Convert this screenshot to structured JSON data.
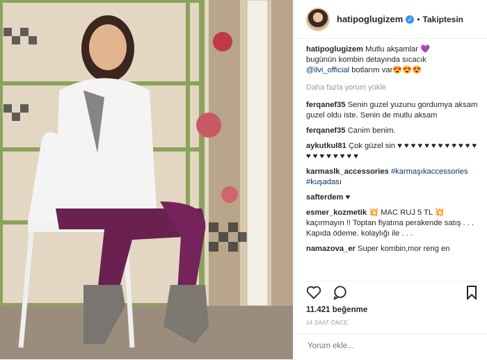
{
  "post": {
    "username": "hatipoglugizem",
    "verified_icon": "verified-badge-icon",
    "follow_status": "Takiptesin",
    "separator": "•"
  },
  "caption": {
    "user": "hatipoglugizem",
    "line1": "Mutlu akşamlar",
    "heart": "💜",
    "line2": "bugünün kombin detayında sıcacık",
    "mention": "@ilvi_official",
    "line3": "botlarım var",
    "emojis": "😍😍😍"
  },
  "load_more": "Daha fazla yorum yükle",
  "comments": [
    {
      "user": "ferqanef35",
      "text": "Senin guzel yuzunu gordumya aksam guzel oldu iste. Senin de mutlu aksam"
    },
    {
      "user": "ferqanef35",
      "text": "Canim benim."
    },
    {
      "user": "aykutkul81",
      "text": "Çok güzel sin ♥ ♥ ♥ ♥ ♥ ♥ ♥ ♥ ♥ ♥ ♥ ♥ ♥ ♥ ♥ ♥ ♥ ♥ ♥ ♥"
    },
    {
      "user": "karmaslk_accessories",
      "text": "#karmaşıkaccessories #kuşadası"
    },
    {
      "user": "safterdem",
      "text": "♥"
    },
    {
      "user": "esmer_kozmetik",
      "text": "💥 MAC RUJ 5 TL 💥 kaçırmayın !! Toptan fiyatına perakende satış . . . Kapıda ödeme. kolaylığı ile . . ."
    },
    {
      "user": "namazova_er",
      "text": "Super kombin,mor reng en"
    }
  ],
  "likes": "11.421 beğenme",
  "timestamp": "14 SAAT ÖNCE",
  "add_comment_placeholder": "Yorum ekle...",
  "colors": {
    "link": "#003569",
    "muted": "#999999",
    "verified": "#3897f0",
    "text": "#262626"
  }
}
